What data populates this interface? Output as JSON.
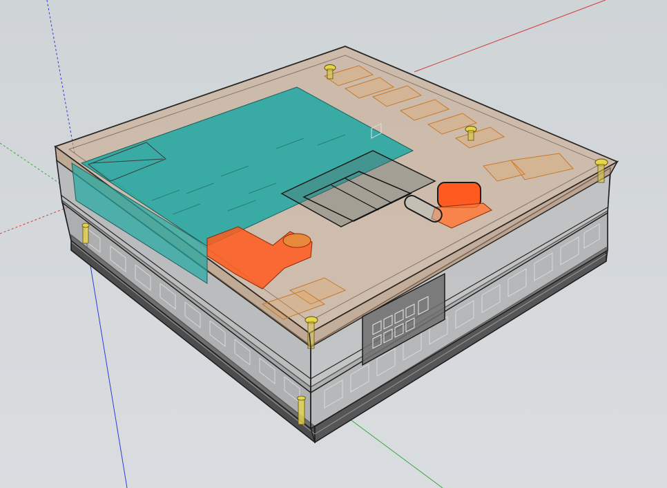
{
  "viewport": {
    "background_color": "#d3d7da",
    "axis_colors": {
      "red": "#d23b3b",
      "green": "#3aa83a",
      "blue": "#2c3ad8"
    }
  },
  "model": {
    "shell_color": "#c8a685",
    "outline_color": "#2a2622",
    "screen_color": "#20a8a2",
    "accent_color": "#ff5a1f",
    "screw_color": "#e6d44a",
    "label_color": "#6f6f6f"
  }
}
